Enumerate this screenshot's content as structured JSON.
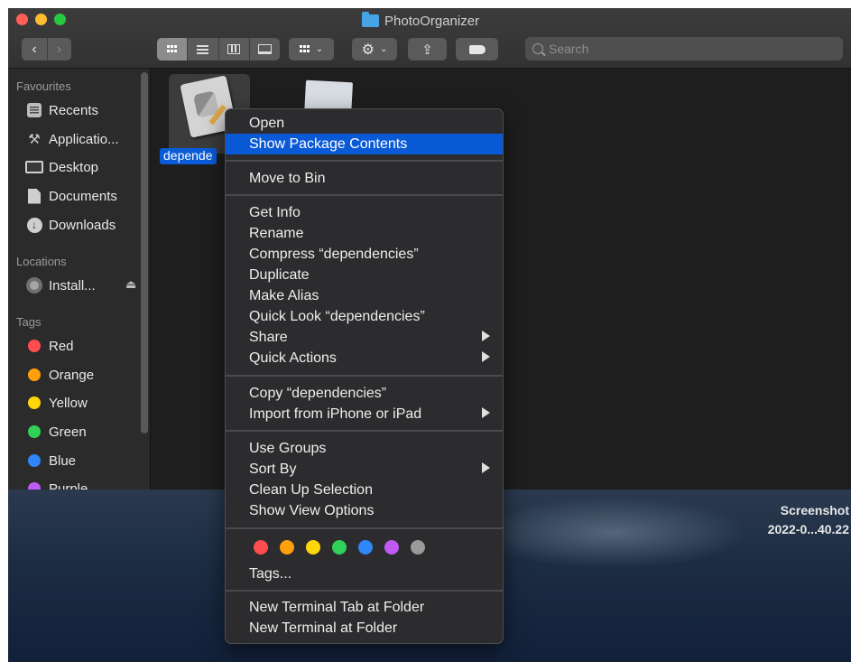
{
  "window": {
    "title": "PhotoOrganizer",
    "search_placeholder": "Search"
  },
  "sidebar": {
    "sections": {
      "favourites": "Favourites",
      "locations": "Locations",
      "tags": "Tags"
    },
    "favourites": [
      {
        "label": "Recents",
        "icon": "recents-icon"
      },
      {
        "label": "Applicatio...",
        "icon": "applications-icon"
      },
      {
        "label": "Desktop",
        "icon": "desktop-icon"
      },
      {
        "label": "Documents",
        "icon": "documents-icon"
      },
      {
        "label": "Downloads",
        "icon": "downloads-icon"
      }
    ],
    "locations": [
      {
        "label": "Install...",
        "icon": "disk-icon"
      }
    ],
    "tags": [
      {
        "label": "Red",
        "color": "#ff4d4f"
      },
      {
        "label": "Orange",
        "color": "#ff9f0a"
      },
      {
        "label": "Yellow",
        "color": "#ffd60a"
      },
      {
        "label": "Green",
        "color": "#30d158"
      },
      {
        "label": "Blue",
        "color": "#2f86f6"
      },
      {
        "label": "Purple",
        "color": "#bf5af2"
      }
    ]
  },
  "content": {
    "files": [
      {
        "label": "depende",
        "icon": "python-file-icon",
        "selected": true
      },
      {
        "label": "",
        "icon": "document-icon",
        "selected": false
      }
    ]
  },
  "context_menu": {
    "items": [
      {
        "label": "Open"
      },
      {
        "label": "Show Package Contents",
        "highlighted": true
      },
      {
        "label": "Move to Bin"
      },
      {
        "label": "Get Info"
      },
      {
        "label": "Rename"
      },
      {
        "label": "Compress “dependencies”"
      },
      {
        "label": "Duplicate"
      },
      {
        "label": "Make Alias"
      },
      {
        "label": "Quick Look “dependencies”"
      },
      {
        "label": "Share",
        "submenu": true
      },
      {
        "label": "Quick Actions",
        "submenu": true
      },
      {
        "label": "Copy “dependencies”"
      },
      {
        "label": "Import from iPhone or iPad",
        "submenu": true
      },
      {
        "label": "Use Groups"
      },
      {
        "label": "Sort By",
        "submenu": true
      },
      {
        "label": "Clean Up Selection"
      },
      {
        "label": "Show View Options"
      },
      {
        "label": "Tags..."
      },
      {
        "label": "New Terminal Tab at Folder"
      },
      {
        "label": "New Terminal at Folder"
      }
    ],
    "tag_colors": [
      "#ff4d4f",
      "#ff9f0a",
      "#ffd60a",
      "#30d158",
      "#2f86f6",
      "#bf5af2",
      "#9a9a9a"
    ]
  },
  "desktop": {
    "file_label_line1": "Screenshot",
    "file_label_line2": "2022-0...40.22"
  }
}
